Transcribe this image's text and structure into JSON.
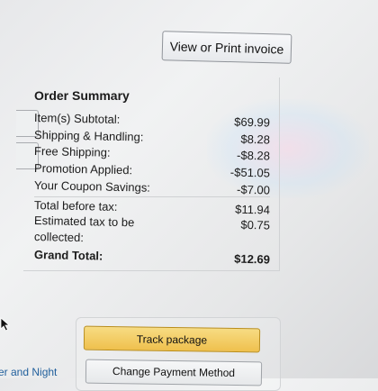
{
  "header": {
    "invoice_button": "View or Print invoice"
  },
  "order_summary": {
    "title": "Order Summary",
    "lines": [
      {
        "label": "Item(s) Subtotal:",
        "value": "$69.99"
      },
      {
        "label": "Shipping & Handling:",
        "value": "$8.28"
      },
      {
        "label": "Free Shipping:",
        "value": "-$8.28"
      },
      {
        "label": "Promotion Applied:",
        "value": "-$51.05"
      },
      {
        "label": "Your Coupon Savings:",
        "value": "-$7.00"
      },
      {
        "label": "Total before tax:",
        "value": "$11.94"
      },
      {
        "label": "Estimated tax to be",
        "value": "$0.75"
      },
      {
        "label": "collected:",
        "value": ""
      }
    ],
    "grand_total": {
      "label": "Grand Total:",
      "value": "$12.69"
    }
  },
  "actions": {
    "track_package": "Track package",
    "change_payment": "Change Payment Method",
    "delivery_link": "er and Night"
  },
  "colors": {
    "track_button": "#efc04d",
    "link": "#1f5e9c"
  }
}
